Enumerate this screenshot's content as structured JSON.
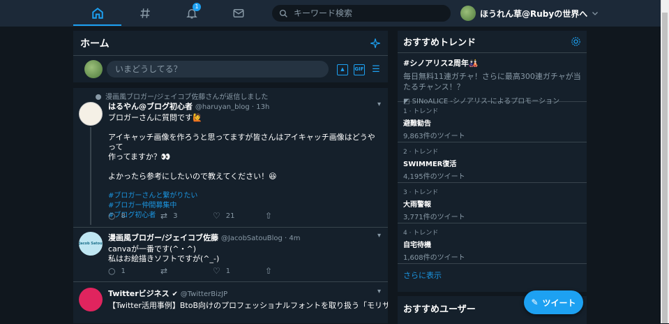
{
  "nav": {
    "items": [
      "home-icon",
      "hashtag-icon",
      "bell-icon",
      "mail-icon"
    ],
    "notification_count": "1",
    "search_placeholder": "キーワード検索",
    "account_name": "ほうれん草@Rubyの世界へ",
    "colors": {
      "bar": "#1c2938",
      "accent": "#1da1f2"
    }
  },
  "main": {
    "title": "ホーム",
    "compose_placeholder": "いまどうしてる？",
    "gif_label": "GIF",
    "tweets": [
      {
        "context": "漫画風ブロガー/ジェイコブ佐藤さんが返信しました",
        "name": "はるやん@ブログ初心者",
        "handle": "@haruyan_blog · 13h",
        "text1": "ブロガーさんに質問です🙋",
        "text2": "アイキャッチ画像を作ろうと思ってますが皆さんはアイキャッチ画像はどうやって\n作ってますか？👀",
        "text3": "よかったら参考にしたいので教えてください！😆",
        "tags": [
          "#ブロガーさんと繋がりたい",
          "#ブロガー仲間募集中",
          "#ブログ初心者"
        ],
        "replies": "8",
        "retweets": "3",
        "likes": "21"
      },
      {
        "name": "漫画風ブロガー/ジェイコブ佐藤",
        "handle": "@JacobSatouBlog · 4m",
        "text": "canvaが一番です(^・^)\n私はお絵描きソフトですが(^_-)",
        "avatar_text": "Jacob Satou",
        "replies": "1",
        "retweets": "",
        "likes": "1"
      },
      {
        "name": "Twitterビジネス",
        "handle": "@TwitterBizJP",
        "text": "【Twitter活用事例】BtoB向けのプロフェッショナルフォントを取り扱う「モリサワ"
      }
    ]
  },
  "sidebar": {
    "trends_title": "おすすめトレンド",
    "promo": {
      "title": "#シノアリス2周年🎎",
      "desc": "毎日無料11連ガチャ！さらに最高300連ガチャが当たるチャンス！？",
      "by": "SINoALICE -シノアリス-によるプロモーション"
    },
    "trends": [
      {
        "meta": "1 · トレンド",
        "name": "避難勧告",
        "count": "9,863件のツイート"
      },
      {
        "meta": "2 · トレンド",
        "name": "SWIMMER復活",
        "count": "4,195件のツイート"
      },
      {
        "meta": "3 · トレンド",
        "name": "大雨警報",
        "count": "3,771件のツイート"
      },
      {
        "meta": "4 · トレンド",
        "name": "自宅待機",
        "count": "1,608件のツイート"
      }
    ],
    "show_more": "さらに表示",
    "users_title": "おすすめユーザー"
  },
  "fab_label": "ツイート"
}
